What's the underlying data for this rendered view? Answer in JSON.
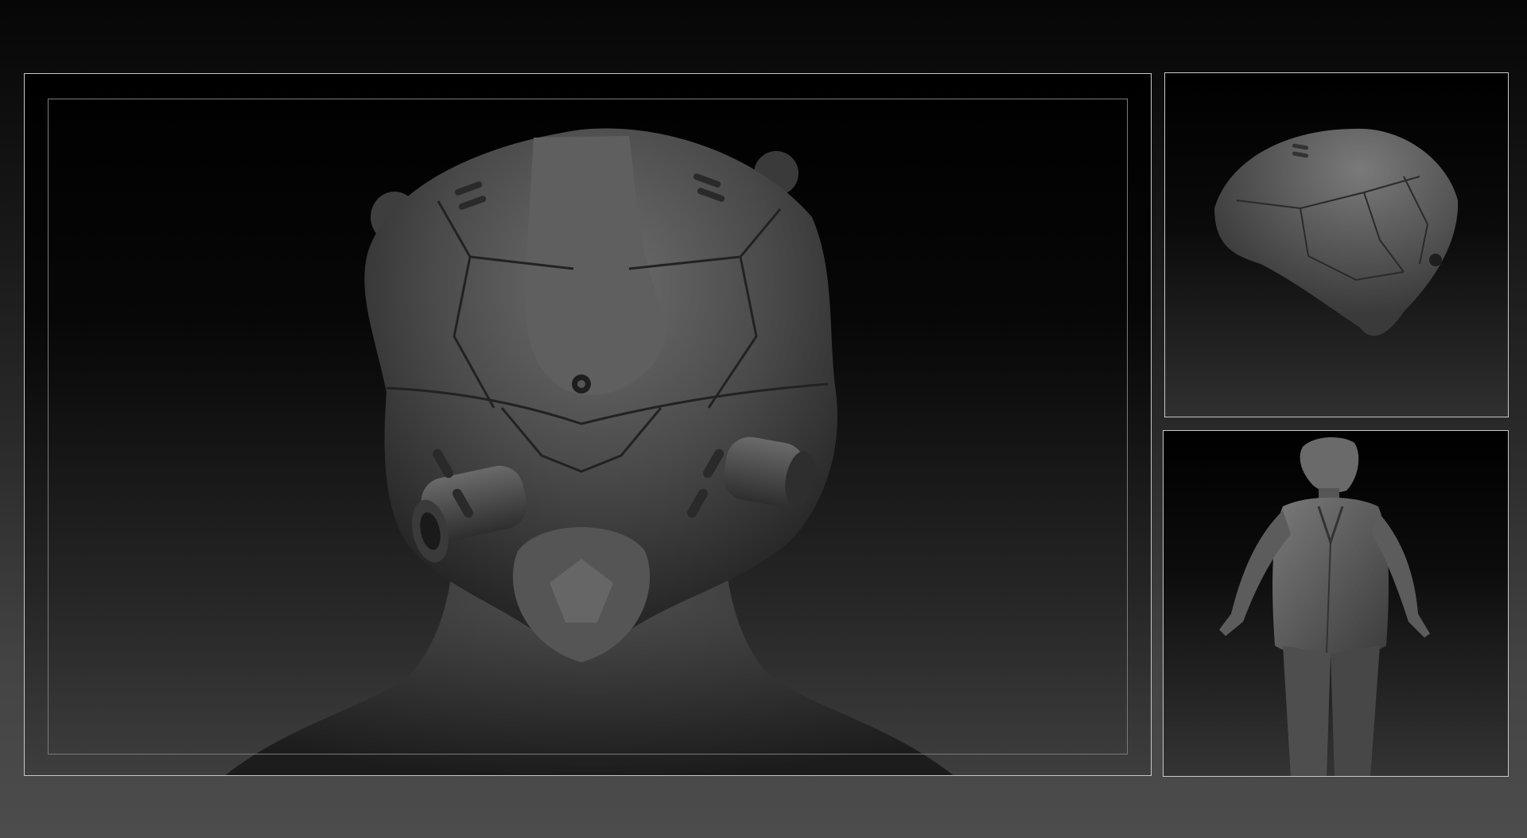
{
  "scene": {
    "background_top": "#060606",
    "background_bottom": "#4c4c4c",
    "panel_border": "#c8c8c8",
    "inner_frame_border": "#7a7a7a",
    "model_color": "#5a5a5a"
  },
  "panels": {
    "main": {
      "view": "helmet-front"
    },
    "top_right": {
      "view": "helmet-three-quarter"
    },
    "bottom_right": {
      "view": "full-figure"
    }
  }
}
